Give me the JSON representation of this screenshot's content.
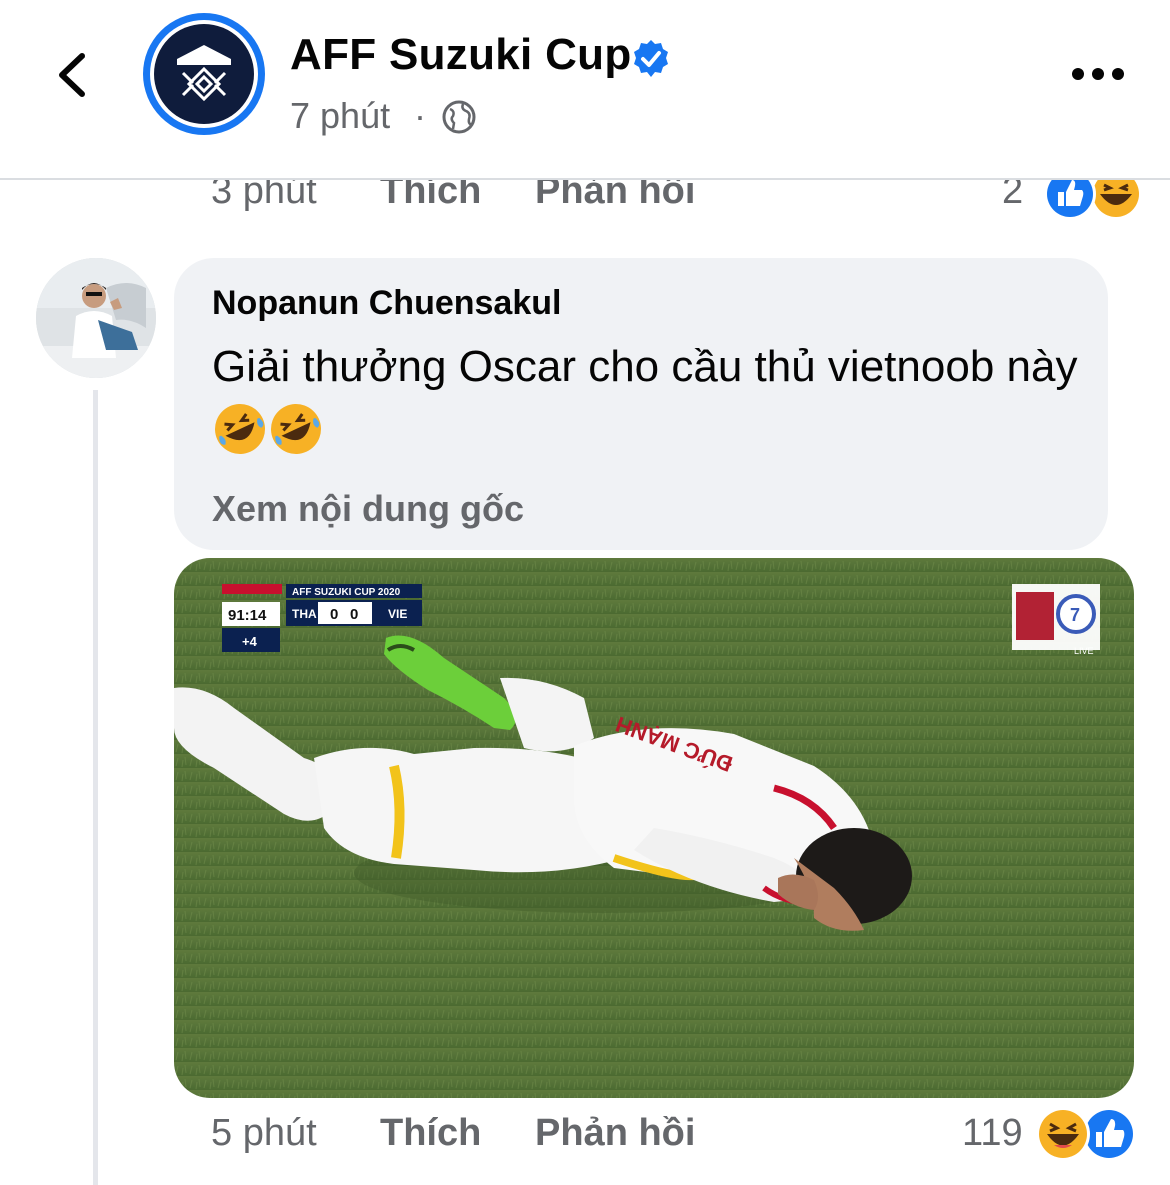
{
  "header": {
    "page_name": "AFF Suzuki Cup",
    "time": "7 phút",
    "separator": "·",
    "icons": [
      "back-arrow-icon",
      "verified-badge-icon",
      "globe-icon",
      "more-options-icon"
    ]
  },
  "previous_comment": {
    "time": "3 phút",
    "like_label": "Thích",
    "reply_label": "Phản hồi",
    "reaction_count": "2",
    "reactions": [
      "like",
      "haha"
    ]
  },
  "comment": {
    "author": "Nopanun Chuensakul",
    "text": "Giải thưởng Oscar cho cầu thủ vietnoob này",
    "emojis": [
      "rolling-on-floor-laughing",
      "rolling-on-floor-laughing"
    ],
    "see_original": "Xem nội dung gốc",
    "time": "5 phút",
    "like_label": "Thích",
    "reply_label": "Phản hồi",
    "reaction_count": "119",
    "reactions": [
      "haha",
      "like"
    ],
    "media": {
      "scoreboard": {
        "tournament": "AFF SUZUKI CUP 2020",
        "clock": "91:14",
        "added_time": "+4",
        "home": "THA",
        "home_score": "0",
        "away_score": "0",
        "away": "VIE"
      },
      "broadcaster_live": "LIVE",
      "jersey_name": "ĐỨC MẠNH"
    }
  },
  "colors": {
    "brand_blue": "#1877f2",
    "secondary_text": "#65676b",
    "bubble_bg": "#f0f2f5",
    "haha_yellow": "#f7b125"
  }
}
